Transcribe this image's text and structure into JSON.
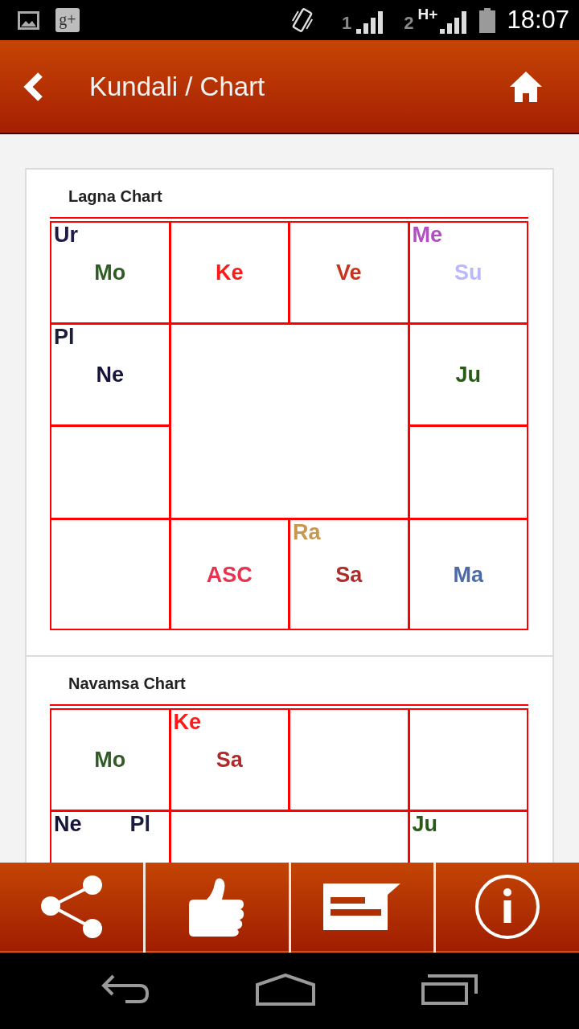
{
  "status_bar": {
    "notification": "g+",
    "sim1_label": "1",
    "sim2_label": "2",
    "network_type": "H+",
    "time": "18:07"
  },
  "header": {
    "title": "Kundali / Chart"
  },
  "charts": [
    {
      "title": "Lagna Chart",
      "cells": [
        {
          "corner": [
            {
              "name": "Ur",
              "color": "#1e1b48"
            }
          ],
          "center": [
            {
              "name": "Mo",
              "color": "#2f5c24"
            }
          ]
        },
        {
          "center": [
            {
              "name": "Ke",
              "color": "#ff1a1a"
            }
          ]
        },
        {
          "center": [
            {
              "name": "Ve",
              "color": "#c9321f"
            }
          ]
        },
        {
          "corner": [
            {
              "name": "Me",
              "color": "#b050c0"
            }
          ],
          "center": [
            {
              "name": "Su",
              "color": "#b8b8ff"
            }
          ]
        },
        {
          "corner": [
            {
              "name": "Pl",
              "color": "#1c1c3c"
            }
          ],
          "center": [
            {
              "name": "Ne",
              "color": "#15153a"
            }
          ]
        },
        {
          "center": [
            {
              "name": "Ju",
              "color": "#2a5a18"
            }
          ]
        },
        {},
        {},
        {},
        {
          "center": [
            {
              "name": "ASC",
              "color": "#e8324f"
            }
          ]
        },
        {
          "corner": [
            {
              "name": "Ra",
              "color": "#c8964f"
            }
          ],
          "center": [
            {
              "name": "Sa",
              "color": "#b02a2a"
            }
          ]
        },
        {
          "center": [
            {
              "name": "Ma",
              "color": "#4a6aaa"
            }
          ]
        }
      ]
    },
    {
      "title": "Navamsa Chart",
      "cells": [
        {
          "center": [
            {
              "name": "Mo",
              "color": "#2f5c24"
            }
          ]
        },
        {
          "corner": [
            {
              "name": "Ke",
              "color": "#ff1a1a"
            }
          ],
          "center": [
            {
              "name": "Sa",
              "color": "#b02a2a"
            }
          ]
        },
        {},
        {},
        {
          "corner": [
            {
              "name": "Ne",
              "color": "#15153a"
            },
            {
              "name": "Pl",
              "color": "#1c1c3c"
            }
          ]
        },
        {
          "corner": [
            {
              "name": "Ju",
              "color": "#2a5a18"
            }
          ]
        }
      ]
    }
  ]
}
